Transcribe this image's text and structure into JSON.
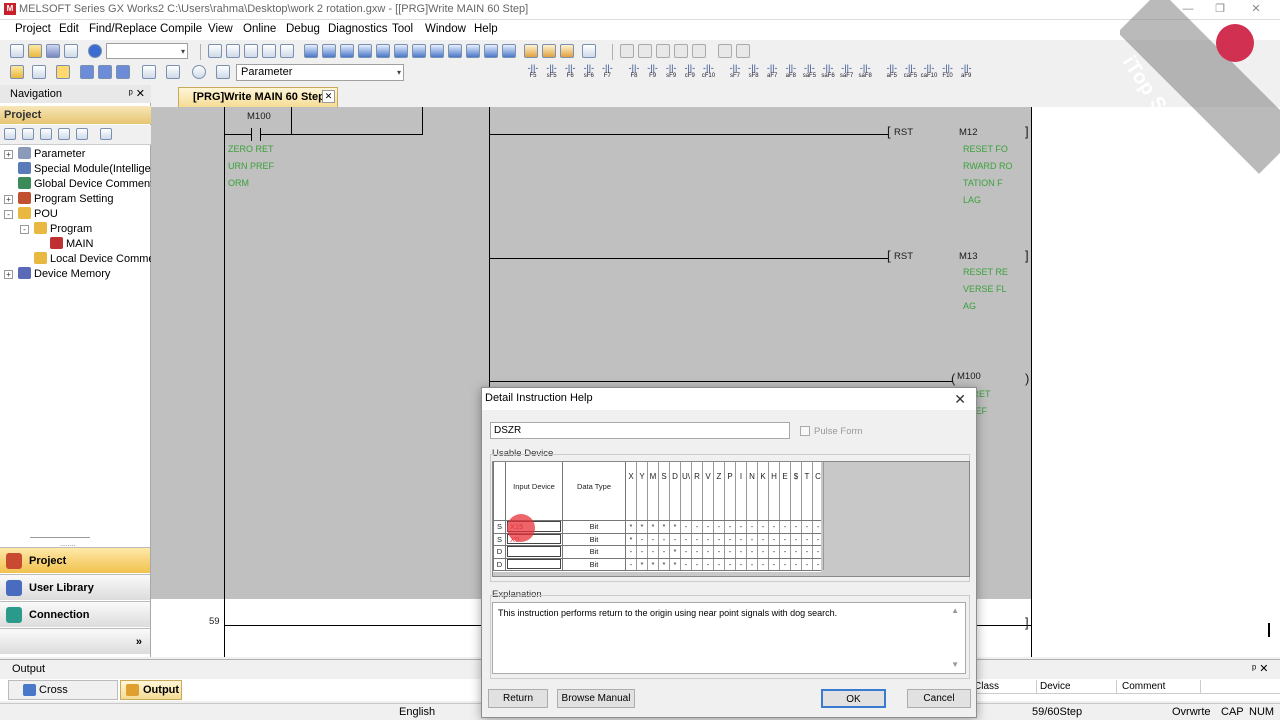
{
  "window": {
    "title": "MELSOFT Series GX Works2 C:\\Users\\rahma\\Desktop\\work 2 rotation.gxw - [[PRG]Write MAIN 60 Step]"
  },
  "menu": [
    "Project",
    "Edit",
    "Find/Replace",
    "Compile",
    "View",
    "Online",
    "Debug",
    "Diagnostics",
    "Tool",
    "Window",
    "Help"
  ],
  "toolbar": {
    "combo_value": "Parameter"
  },
  "fkeys": [
    [
      "F5",
      "",
      ""
    ],
    [
      "sF5",
      "",
      ""
    ],
    [
      "F6",
      "",
      ""
    ],
    [
      "sF6",
      "",
      ""
    ],
    [
      "F7",
      "",
      ""
    ],
    [
      "F8",
      "",
      ""
    ],
    [
      "F9",
      "",
      ""
    ],
    [
      "sF9",
      "",
      ""
    ],
    [
      "cF9",
      "",
      ""
    ],
    [
      "cF10",
      "",
      ""
    ],
    [
      "sF7",
      "",
      ""
    ],
    [
      "sF8",
      "",
      ""
    ],
    [
      "aF7",
      "",
      ""
    ],
    [
      "aF8",
      "",
      ""
    ],
    [
      "saF5",
      "",
      ""
    ],
    [
      "saF6",
      "",
      ""
    ],
    [
      "saF7",
      "",
      ""
    ],
    [
      "saF8",
      "",
      ""
    ],
    [
      "aF5",
      "",
      ""
    ],
    [
      "caF5",
      "",
      ""
    ],
    [
      "caF10",
      "",
      ""
    ],
    [
      "F10",
      "",
      ""
    ],
    [
      "aF9",
      "",
      ""
    ]
  ],
  "navigation": {
    "title": "Navigation",
    "pin": "ᵖ x",
    "project_header": "Project",
    "tree": [
      {
        "label": "Parameter",
        "indent": 0,
        "exp": "+"
      },
      {
        "label": "Special Module(Intelligent",
        "indent": 0,
        "exp": ""
      },
      {
        "label": "Global Device Comment",
        "indent": 0,
        "exp": ""
      },
      {
        "label": "Program Setting",
        "indent": 0,
        "exp": "+"
      },
      {
        "label": "POU",
        "indent": 0,
        "exp": "-"
      },
      {
        "label": "Program",
        "indent": 1,
        "exp": "-"
      },
      {
        "label": "MAIN",
        "indent": 2,
        "exp": ""
      },
      {
        "label": "Local Device Commen",
        "indent": 1,
        "exp": ""
      },
      {
        "label": "Device Memory",
        "indent": 0,
        "exp": "+"
      }
    ],
    "buttons": [
      "Project",
      "User Library",
      "Connection Destination"
    ]
  },
  "tab": {
    "label": "[PRG]Write MAIN 60 Step",
    "close": "✕"
  },
  "ladder": {
    "contact_device": "M100",
    "contact_comment": [
      "ZERO RET",
      "URN PREF",
      "ORM"
    ],
    "rung1": {
      "instr": "RST",
      "device": "M12",
      "comment": [
        "RESET FO",
        "RWARD RO",
        "TATION F",
        "LAG"
      ]
    },
    "rung2": {
      "instr": "RST",
      "device": "M13",
      "comment": [
        "RESET RE",
        "VERSE FL",
        "AG"
      ]
    },
    "coil": {
      "device": "M100",
      "comment": [
        "O RET",
        "PREF"
      ]
    },
    "step": "59"
  },
  "output": {
    "title": "Output",
    "tabs": [
      "Cross Reference",
      "Output"
    ],
    "columns": [
      "Class",
      "Device",
      "Comment"
    ]
  },
  "status": {
    "language": "English",
    "steps": "59/60Step",
    "mode": "Ovrwrte",
    "cap": "CAP",
    "num": "NUM"
  },
  "dialog": {
    "title": "Detail Instruction Help",
    "instruction": "DSZR",
    "pulse_form": "Pulse Form",
    "usable_device_label": "Usable Device",
    "col_input": "Input Device",
    "col_type": "Data Type",
    "device_cols": [
      "X",
      "Y",
      "M",
      "S",
      "D",
      "U\\",
      "R",
      "V",
      "Z",
      "P",
      "I",
      "N",
      "K",
      "H",
      "E",
      "$",
      "T",
      "C"
    ],
    "rows": [
      {
        "op": "S",
        "input": "X15",
        "type": "Bit",
        "marks": [
          "*",
          "*",
          "*",
          "*",
          "*",
          "-",
          "-",
          "-",
          "-",
          "-",
          "-",
          "-",
          "-",
          "-",
          "-",
          "-",
          "-",
          "-"
        ]
      },
      {
        "op": "S",
        "input": "X0",
        "type": "Bit",
        "marks": [
          "*",
          "-",
          "-",
          "-",
          "-",
          "-",
          "-",
          "-",
          "-",
          "-",
          "-",
          "-",
          "-",
          "-",
          "-",
          "-",
          "-",
          "-"
        ]
      },
      {
        "op": "D",
        "input": "",
        "type": "Bit",
        "marks": [
          "-",
          "-",
          "-",
          "-",
          "*",
          "-",
          "-",
          "-",
          "-",
          "-",
          "-",
          "-",
          "-",
          "-",
          "-",
          "-",
          "-",
          "-"
        ]
      },
      {
        "op": "D",
        "input": "",
        "type": "Bit",
        "marks": [
          "-",
          "*",
          "*",
          "*",
          "*",
          "-",
          "-",
          "-",
          "-",
          "-",
          "-",
          "-",
          "-",
          "-",
          "-",
          "-",
          "-",
          "-"
        ]
      }
    ],
    "explanation_label": "Explanation",
    "explanation": "This instruction performs return to the origin using near point signals with dog search.",
    "buttons": {
      "return": "Return",
      "browse": "Browse Manual",
      "ok": "OK",
      "cancel": "Cancel"
    }
  },
  "watermark": "iTop Screen Recorder",
  "colors": {
    "accent": "#f5dc94",
    "ladder_gray": "#c0c0c0",
    "comment_green": "#3aa13a",
    "cursor_red": "#e8303a"
  }
}
